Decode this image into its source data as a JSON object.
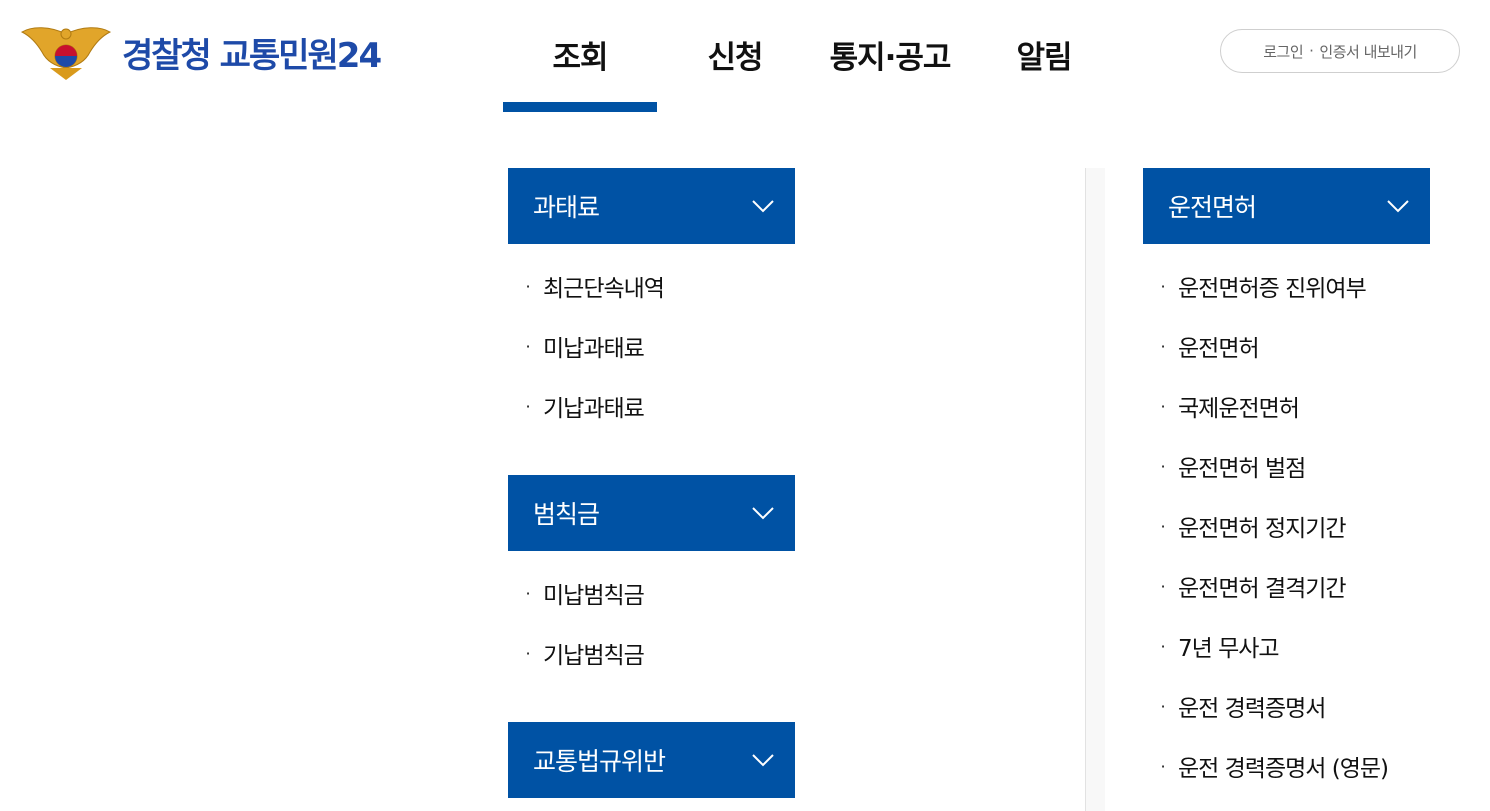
{
  "header": {
    "brand": "경찰청 교통민원24",
    "nav": [
      "조회",
      "신청",
      "통지·공고",
      "알림"
    ],
    "login_part1": "로그인",
    "login_part2": "인증서 내보내기",
    "login_sep": "·"
  },
  "menu": {
    "fine": {
      "title": "과태료",
      "items": [
        "최근단속내역",
        "미납과태료",
        "기납과태료"
      ]
    },
    "penalty": {
      "title": "범칙금",
      "items": [
        "미납범칙금",
        "기납범칙금"
      ]
    },
    "violation": {
      "title": "교통법규위반"
    },
    "license": {
      "title": "운전면허",
      "items": [
        "운전면허증 진위여부",
        "운전면허",
        "국제운전면허",
        "운전면허 벌점",
        "운전면허 정지기간",
        "운전면허 결격기간",
        "7년 무사고",
        "운전 경력증명서",
        "운전 경력증명서 (영문)"
      ]
    }
  },
  "bullet": "·",
  "colors": {
    "primary": "#0052a4",
    "brand_text": "#1e4aa8",
    "emblem_gold": "#e1a52a"
  },
  "icons": {
    "emblem": "police-emblem-icon",
    "chevron": "chevron-down-icon"
  }
}
